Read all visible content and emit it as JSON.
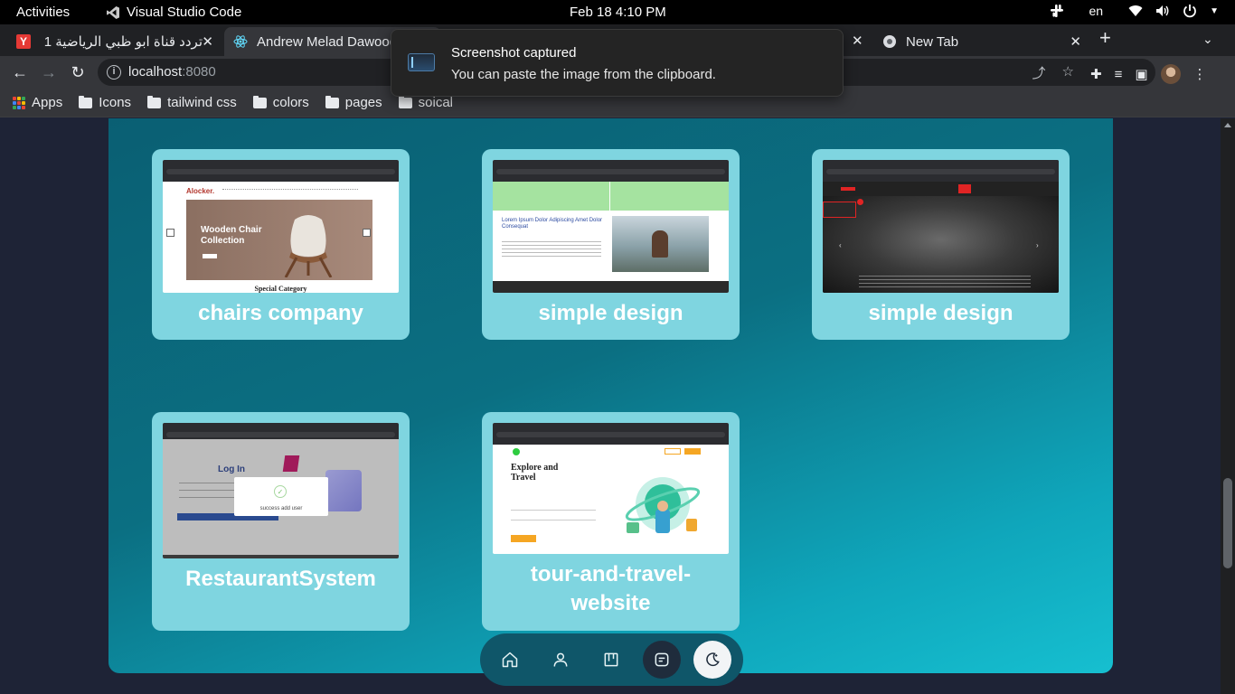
{
  "system_bar": {
    "activities": "Activities",
    "app_name": "Visual Studio Code",
    "clock": "Feb 18  4:10 PM",
    "language": "en"
  },
  "browser": {
    "tabs": [
      {
        "label": "تردد قناة ابو ظبي الرياضية 1",
        "active": false,
        "favicon": "yandex-icon"
      },
      {
        "label": "Andrew Melad Dawood",
        "active": true,
        "favicon": "react-icon"
      },
      {
        "label": "New Tab",
        "active": false,
        "favicon": "chrome-icon"
      }
    ],
    "url_host": "localhost",
    "url_port": ":8080",
    "bookmarks": [
      "Apps",
      "Icons",
      "tailwind css",
      "colors",
      "pages",
      "soical"
    ]
  },
  "toast": {
    "title": "Screenshot captured",
    "message": "You can paste the image from the clipboard."
  },
  "projects": [
    {
      "title": "chairs company",
      "thumb": "wooden-chair-site"
    },
    {
      "title": "simple design",
      "thumb": "lorem-landscape-site"
    },
    {
      "title": "simple design",
      "thumb": "dark-hero-site"
    },
    {
      "title": "RestaurantSystem",
      "thumb": "login-success-modal"
    },
    {
      "title": "tour-and-travel-website",
      "thumb": "explore-travel-site"
    }
  ],
  "thumb_text": {
    "chair_logo": "Alocker.",
    "chair_heading": "Wooden Chair Collection",
    "chair_section": "Special Category",
    "lorem_heading": "Lorem Ipsum Dolor Adipiscing Amet Dolor Consequat",
    "login_heading": "Log In",
    "login_success": "success add user",
    "travel_heading": "Explore and Travel"
  },
  "dock": {
    "items": [
      "home-icon",
      "user-icon",
      "projects-icon",
      "message-icon",
      "theme-toggle-icon"
    ],
    "active_index": 4
  },
  "colors": {
    "panel_start": "#0a5f73",
    "panel_end": "#16bfd0",
    "card": "#7fd5e0",
    "dock": "#0f5669"
  }
}
